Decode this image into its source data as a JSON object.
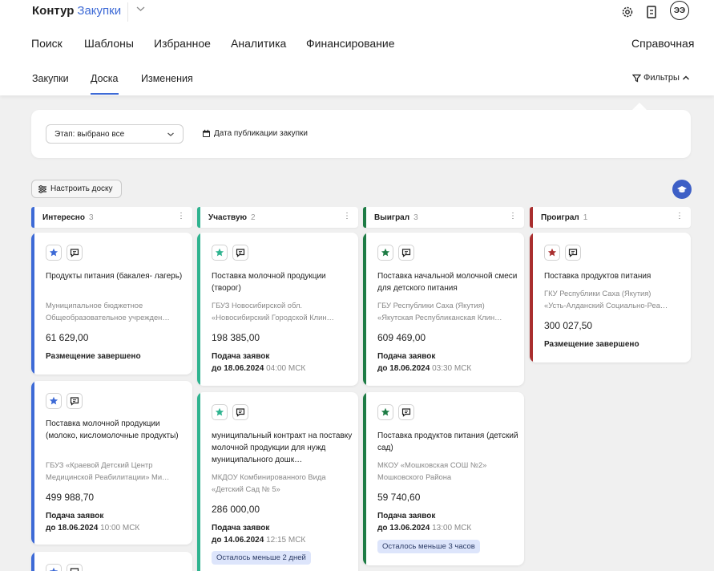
{
  "brand": {
    "name": "Контур",
    "product": "Закупки"
  },
  "colors": {
    "interesting": "#3d6ad6",
    "participating": "#2fb38f",
    "won": "#1e7c45",
    "lost": "#a92e2e",
    "accent": "#3d6ad6"
  },
  "header": {
    "user_initials": "ЭЭ",
    "icons": [
      "gear-icon",
      "document-icon"
    ]
  },
  "nav": {
    "search": "Поиск",
    "templates": "Шаблоны",
    "favorites": "Избранное",
    "analytics": "Аналитика",
    "financing": "Финансирование",
    "reference": "Справочная"
  },
  "subnav": {
    "purchases": "Закупки",
    "board": "Доска",
    "changes": "Изменения",
    "active": "Доска"
  },
  "filters": {
    "label": "Фильтры",
    "stage_select": "Этап: выбрано все",
    "date_filter": "Дата публикации закупки"
  },
  "board": {
    "configure_label": "Настроить доску"
  },
  "columns": [
    {
      "name": "Интересно",
      "count": "3",
      "cards": [
        {
          "title": "Продукты питания (бакалея- лагерь)",
          "org1": "Муниципальное бюджетное",
          "org2": "Общеобразовательное учрежден…",
          "price": "61 629,00",
          "status": "Размещение завершено"
        },
        {
          "title": "Поставка молочной продукции (молоко, кисломолочные продукты)",
          "org1": "ГБУЗ «Краевой Детский Центр",
          "org2": "Медицинской Реабилитации» Ми…",
          "price": "499 988,70",
          "deadline_label": "Подача заявок",
          "deadline_date": "до 18.06.2024",
          "deadline_time": "10:00 МСК"
        }
      ]
    },
    {
      "name": "Участвую",
      "count": "2",
      "cards": [
        {
          "title": "Поставка молочной продукции (творог)",
          "org1": "ГБУЗ Новосибирской обл.",
          "org2": "«Новосибирский Городской Клин…",
          "price": "198 385,00",
          "deadline_label": "Подача заявок",
          "deadline_date": "до 18.06.2024",
          "deadline_time": "04:00 МСК"
        },
        {
          "title": "муниципальный контракт на поставку молочной продукции для нужд муниципального дошк…",
          "org1": "МКДОУ Комбинированного Вида",
          "org2": "«Детский Сад № 5»",
          "price": "286 000,00",
          "deadline_label": "Подача заявок",
          "deadline_date": "до 14.06.2024",
          "deadline_time": "12:15 МСК",
          "badge": "Осталось меньше 2 дней"
        }
      ]
    },
    {
      "name": "Выиграл",
      "count": "3",
      "cards": [
        {
          "title": "Поставка начальной молочной смеси для детского питания",
          "org1": "ГБУ Республики Саха (Якутия)",
          "org2": "«Якутская Республиканская Клин…",
          "price": "609 469,00",
          "deadline_label": "Подача заявок",
          "deadline_date": "до 18.06.2024",
          "deadline_time": "03:30 МСК"
        },
        {
          "title": "Поставка продуктов питания (детский сад)",
          "org1": "МКОУ «Мошковская СОШ №2»",
          "org2": "Мошковского Района",
          "price": "59 740,60",
          "deadline_label": "Подача заявок",
          "deadline_date": "до 13.06.2024",
          "deadline_time": "13:00 МСК",
          "badge": "Осталось меньше 3 часов"
        }
      ]
    },
    {
      "name": "Проиграл",
      "count": "1",
      "cards": [
        {
          "title": "Поставка продуктов питания",
          "org1": "ГКУ Республики Саха (Якутия)",
          "org2": "«Усть-Алданский Социально-Реа…",
          "price": "300 027,50",
          "status": "Размещение завершено"
        }
      ]
    }
  ]
}
